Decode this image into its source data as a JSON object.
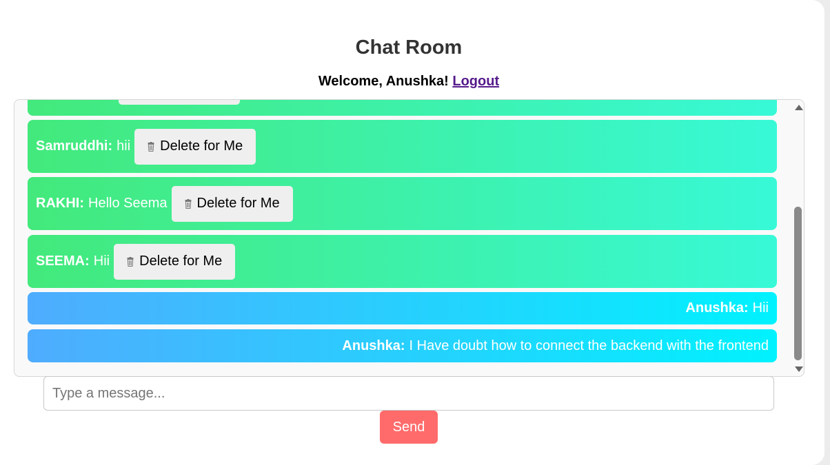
{
  "header": {
    "title": "Chat Room",
    "welcome_prefix": "Welcome, Anushka!",
    "logout_label": "Logout"
  },
  "messages": [
    {
      "sender": "Samruddhi:",
      "text": "hii",
      "mine": false,
      "delete_label": "Delete for Me"
    },
    {
      "sender": "RAKHI:",
      "text": "Hello Seema",
      "mine": false,
      "delete_label": "Delete for Me"
    },
    {
      "sender": "SEEMA:",
      "text": "Hii",
      "mine": false,
      "delete_label": "Delete for Me"
    },
    {
      "sender": "Anushka:",
      "text": "Hii",
      "mine": true
    },
    {
      "sender": "Anushka:",
      "text": "I Have doubt how to connect the backend with the frontend",
      "mine": true
    }
  ],
  "composer": {
    "placeholder": "Type a message...",
    "value": "",
    "send_label": "Send"
  },
  "icons": {
    "delete": "trash-icon"
  },
  "colors": {
    "other_gradient_start": "#43e97b",
    "other_gradient_end": "#38f9d7",
    "mine_gradient_start": "#4facfe",
    "mine_gradient_end": "#00f2fe",
    "send_button": "#ff6b6b",
    "logout_link": "#551a8b"
  }
}
